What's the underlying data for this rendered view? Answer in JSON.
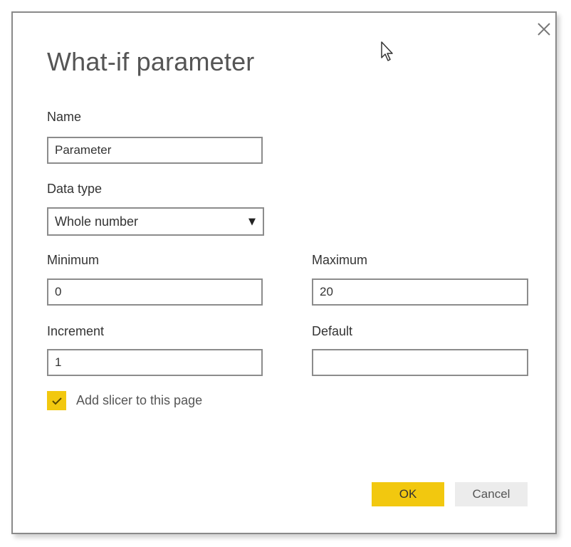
{
  "dialog": {
    "title": "What-if parameter",
    "close_icon": "close-icon"
  },
  "fields": {
    "name": {
      "label": "Name",
      "value": "Parameter"
    },
    "data_type": {
      "label": "Data type",
      "value": "Whole number",
      "arrow_icon": "▼"
    },
    "minimum": {
      "label": "Minimum",
      "value": "0"
    },
    "maximum": {
      "label": "Maximum",
      "value": "20"
    },
    "increment": {
      "label": "Increment",
      "value": "1"
    },
    "default": {
      "label": "Default",
      "value": ""
    }
  },
  "slicer": {
    "label": "Add slicer to this page",
    "checked": true
  },
  "buttons": {
    "ok": "OK",
    "cancel": "Cancel"
  },
  "colors": {
    "accent": "#f2c80f",
    "cancel_bg": "#ececec",
    "border": "#8c8c8c"
  }
}
